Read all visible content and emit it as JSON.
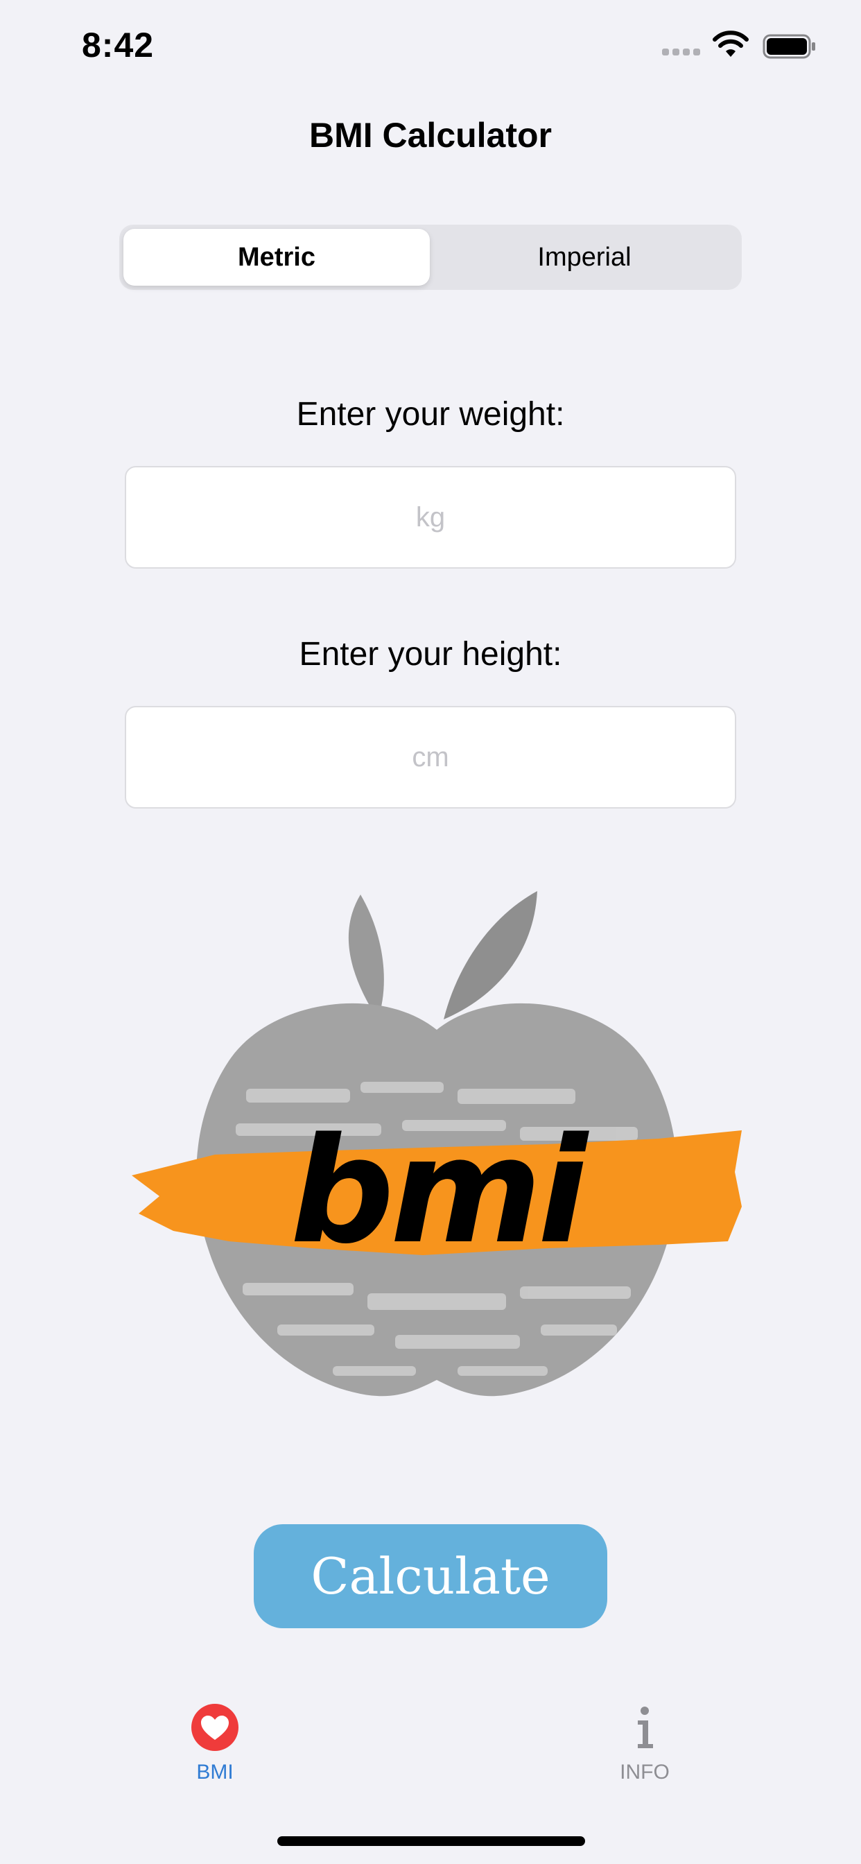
{
  "status_bar": {
    "time": "8:42"
  },
  "header": {
    "title": "BMI Calculator"
  },
  "unit_toggle": {
    "selected": "Metric",
    "options": [
      "Metric",
      "Imperial"
    ]
  },
  "weight": {
    "label": "Enter your weight:",
    "value": "",
    "placeholder": "kg"
  },
  "height": {
    "label": "Enter your height:",
    "value": "",
    "placeholder": "cm"
  },
  "illustration": {
    "text": "bmi"
  },
  "calculate": {
    "label": "Calculate"
  },
  "tab_bar": {
    "tabs": [
      {
        "label": "BMI",
        "icon": "heart-icon",
        "selected": true
      },
      {
        "label": "INFO",
        "icon": "info-icon",
        "selected": false
      }
    ]
  },
  "colors": {
    "background": "#f2f2f7",
    "accent_button": "#64b1dc",
    "tab_selected": "#2f7bd3",
    "heart": "#ef3b3b",
    "brush": "#f7941d"
  }
}
